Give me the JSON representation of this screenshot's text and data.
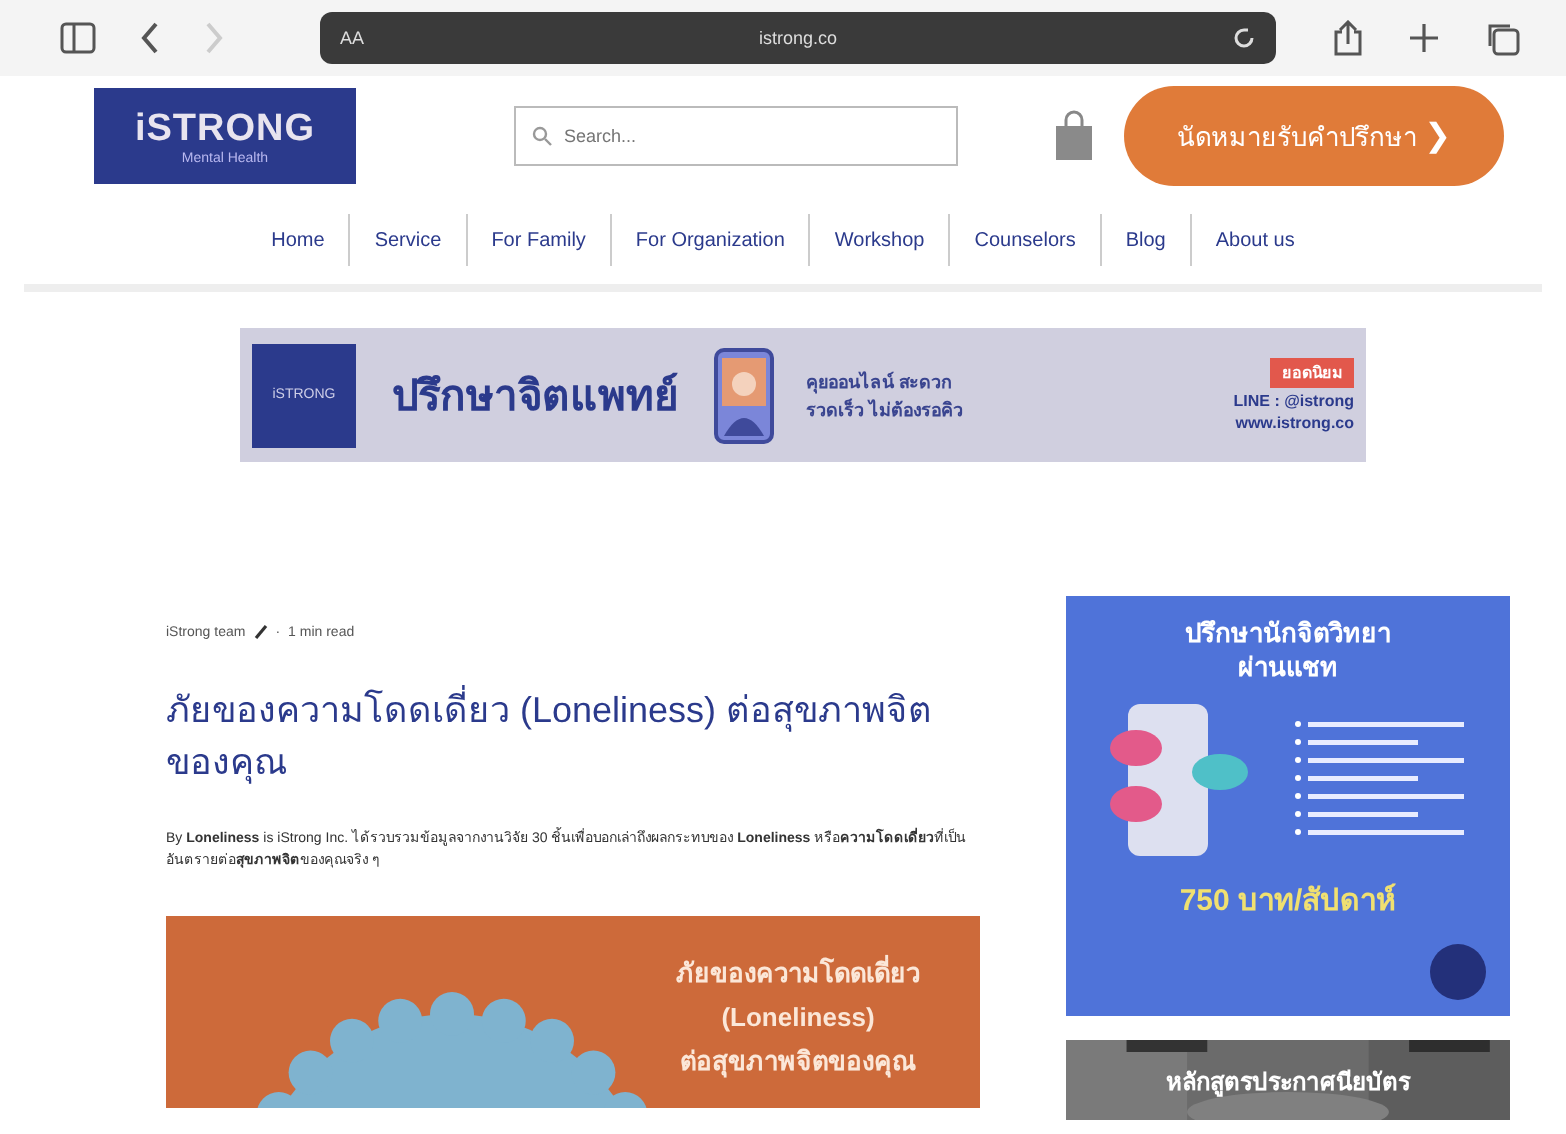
{
  "browser": {
    "reader_label": "AA",
    "url": "istrong.co"
  },
  "header": {
    "logo_title": "iSTRONG",
    "logo_subtitle": "Mental Health",
    "search": {
      "placeholder": "Search..."
    },
    "cta": "นัดหมายรับคำปรึกษา",
    "cta_arrow": "❯"
  },
  "nav": [
    {
      "label": "Home"
    },
    {
      "label": "Service"
    },
    {
      "label": "For Family"
    },
    {
      "label": "For Organization"
    },
    {
      "label": "Workshop"
    },
    {
      "label": "Counselors"
    },
    {
      "label": "Blog"
    },
    {
      "label": "About us"
    }
  ],
  "banner": {
    "logo": "iSTRONG",
    "title": "ปรึกษาจิตแพทย์",
    "tagline_1": "คุยออนไลน์ สะดวก",
    "tagline_2": "รวดเร็ว ไม่ต้องรอคิว",
    "badge": "ยอดนิยม",
    "line": "LINE : @istrong",
    "website": "www.istrong.co"
  },
  "article": {
    "author": "iStrong team",
    "separator": "·",
    "read_time": "1 min read",
    "title": "ภัยของความโดดเดี่ยว (Loneliness) ต่อสุขภาพจิตของคุณ",
    "intro": "By **Loneliness** is iStrong Inc. ได้รวบรวมข้อมูลจากงานวิจัย 30 ชิ้นเพื่อบอกเล่าถึงผลกระทบของ **Loneliness** หรือ**ความโดดเดี่ยว**ที่เป็นอันตรายต่อ**สุขภาพจิต**ของคุณจริง ๆ",
    "cover_title_1": "ภัยของความโดดเดี่ยว",
    "cover_title_2": "(Loneliness)",
    "cover_title_3": "ต่อสุขภาพจิตของคุณ"
  },
  "sidebar": {
    "ad_title_1": "ปรึกษานักจิตวิทยา",
    "ad_title_2": "ผ่านแชท",
    "price": "750 บาท/สัปดาห์",
    "course_title": "หลักสูตรประกาศนียบัตร"
  }
}
